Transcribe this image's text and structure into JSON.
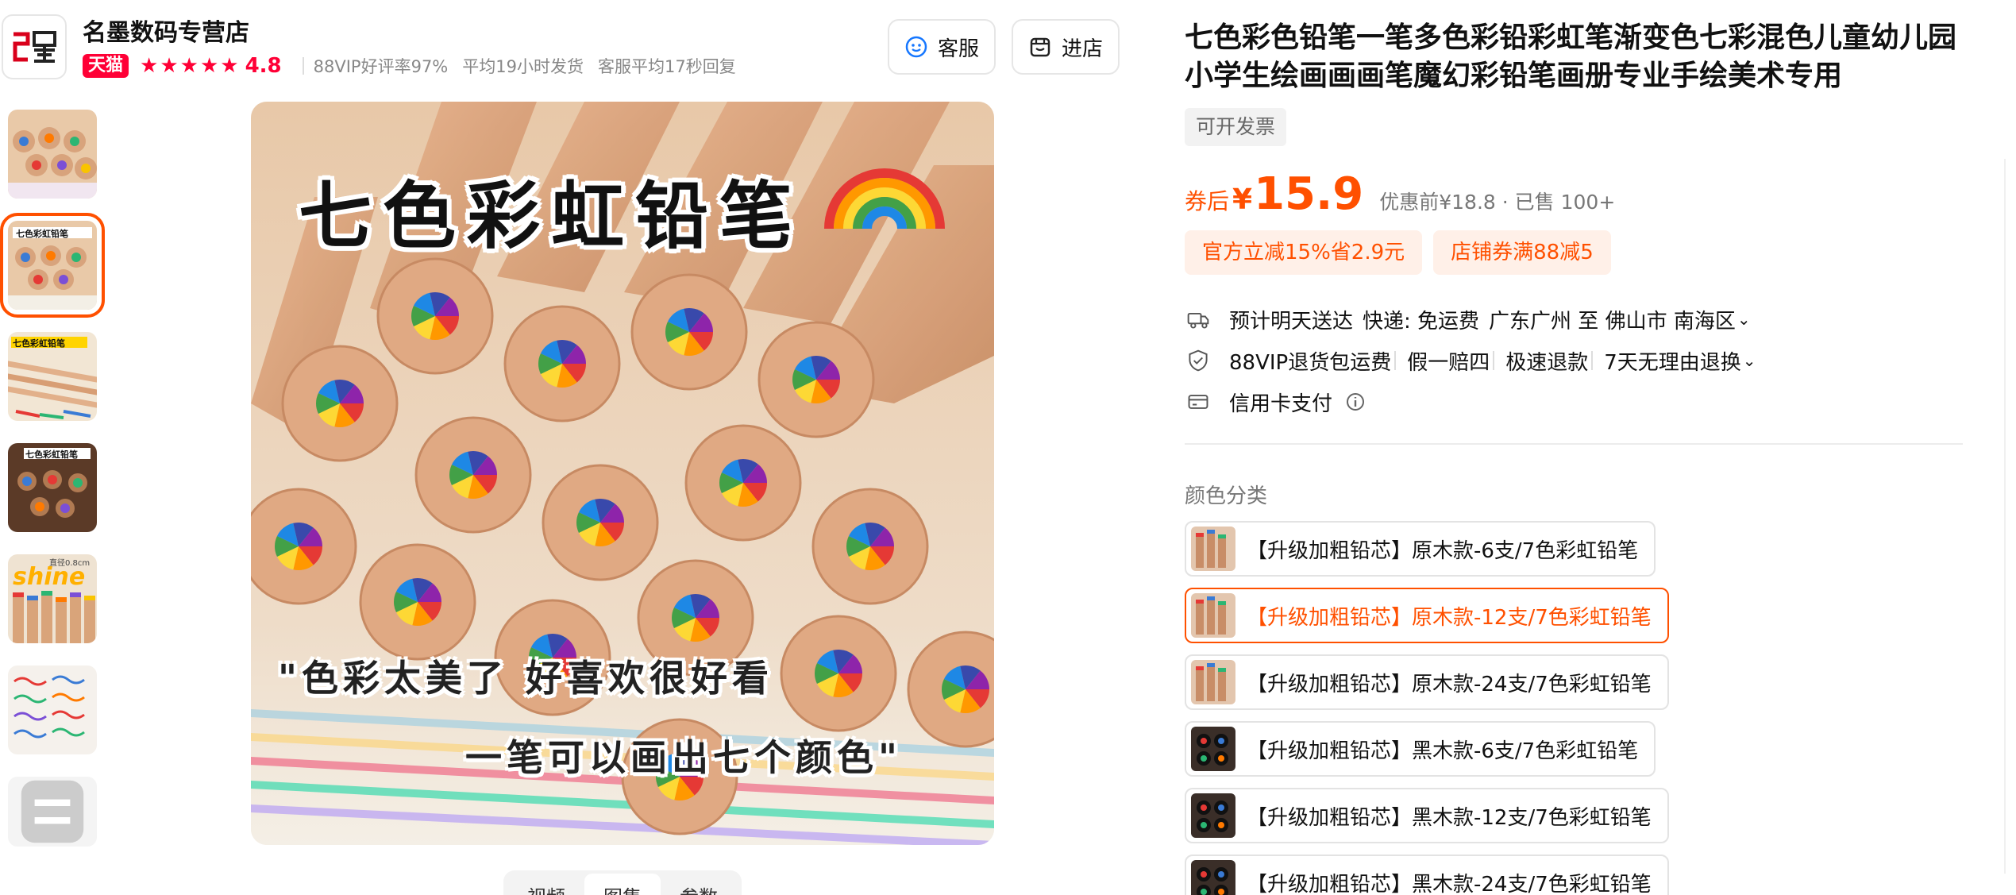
{
  "store": {
    "name": "名墨数码专营店",
    "logo_text": "名墨",
    "badge": "天猫",
    "rating": "4.8",
    "vip_rate": "88VIP好评率97%",
    "ship_time": "平均19小时发货",
    "reply_time": "客服平均17秒回复",
    "service_button": "客服",
    "enter_button": "进店"
  },
  "gallery": {
    "overlay_title": "七色彩虹铅笔",
    "quote_line1": "\"色彩太美了 好喜欢很好看",
    "quote_line2": "一笔可以画出七个颜色\"",
    "thumb_labels": [
      "七色彩虹铅笔",
      "七色彩虹铅笔",
      "七色彩虹铅笔",
      "七色彩虹铅笔",
      "直径0.8cm"
    ],
    "tabs": [
      "视频",
      "图集",
      "参数"
    ],
    "active_tab": "图集"
  },
  "product": {
    "title": "七色彩色铅笔一笔多色彩铅彩虹笔渐变色七彩混色儿童幼儿园小学生绘画画画笔魔幻彩铅笔画册专业手绘美术专用",
    "invoice_tag": "可开发票",
    "price_prefix": "券后",
    "currency": "¥",
    "price": "15.9",
    "original_price": "优惠前¥18.8 · 已售 100+",
    "promos": [
      "官方立减15%省2.9元",
      "店铺券满88减5"
    ]
  },
  "delivery": {
    "eta": "预计明天送达",
    "shipping": "快递: 免运费",
    "route": "广东广州 至 佛山市 南海区"
  },
  "returns": {
    "vip": "88VIP退货包运费",
    "fake": "假一赔四",
    "fast": "极速退款",
    "seven_day": "7天无理由退换"
  },
  "payment": {
    "label": "信用卡支付"
  },
  "sku": {
    "label": "颜色分类",
    "options": [
      {
        "text": "【升级加粗铅芯】原木款-6支/7色彩虹铅笔",
        "style": "wood"
      },
      {
        "text": "【升级加粗铅芯】原木款-12支/7色彩虹铅笔",
        "style": "wood"
      },
      {
        "text": "【升级加粗铅芯】原木款-24支/7色彩虹铅笔",
        "style": "wood"
      },
      {
        "text": "【升级加粗铅芯】黑木款-6支/7色彩虹铅笔",
        "style": "black"
      },
      {
        "text": "【升级加粗铅芯】黑木款-12支/7色彩虹铅笔",
        "style": "black"
      },
      {
        "text": "【升级加粗铅芯】黑木款-24支/7色彩虹铅笔",
        "style": "black"
      }
    ],
    "selected_index": 1
  },
  "colors": {
    "accent": "#ff5000",
    "tmall": "#ff0036"
  }
}
